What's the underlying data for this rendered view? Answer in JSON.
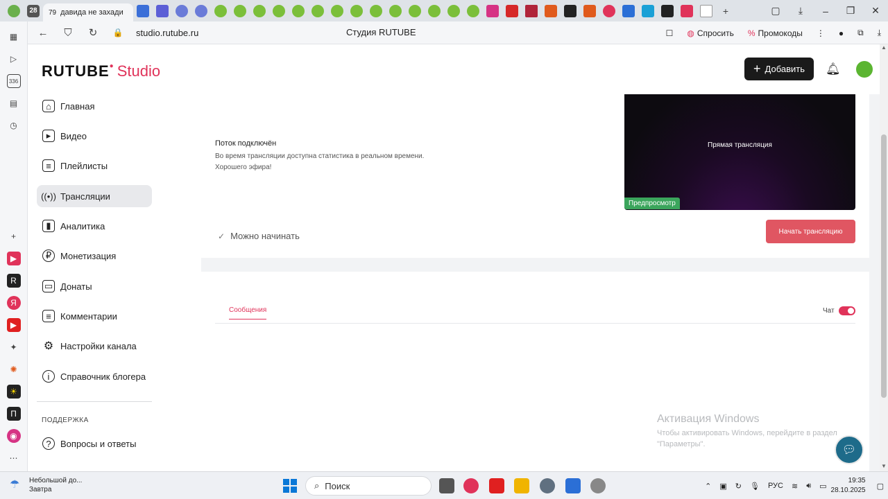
{
  "browser": {
    "active_tab": {
      "count": "79",
      "title": "давида не захади"
    },
    "url": "studio.rutube.ru",
    "page_title": "Студия RUTUBE",
    "ask_label": "Спросить",
    "promo_label": "Промокоды",
    "tab_counter": "28"
  },
  "header": {
    "logo_text": "RUTUBE",
    "logo_studio": "Studio",
    "add_label": "Добавить"
  },
  "sidebar": {
    "items": [
      {
        "label": "Главная",
        "icon": "home-icon"
      },
      {
        "label": "Видео",
        "icon": "video-icon"
      },
      {
        "label": "Плейлисты",
        "icon": "playlist-icon"
      },
      {
        "label": "Трансляции",
        "icon": "broadcast-icon"
      },
      {
        "label": "Аналитика",
        "icon": "analytics-icon"
      },
      {
        "label": "Монетизация",
        "icon": "monetization-icon"
      },
      {
        "label": "Донаты",
        "icon": "donations-icon"
      },
      {
        "label": "Комментарии",
        "icon": "comments-icon"
      },
      {
        "label": "Настройки канала",
        "icon": "gear-icon"
      },
      {
        "label": "Справочник блогера",
        "icon": "info-icon"
      }
    ],
    "support_heading": "ПОДДЕРЖКА",
    "support_items": [
      {
        "label": "Вопросы и ответы",
        "icon": "question-icon"
      }
    ]
  },
  "stream": {
    "status_title": "Поток подключён",
    "desc_line1": "Во время трансляции доступна статистика в реальном времени.",
    "desc_line2": "Хорошего эфира!",
    "preview_title": "Прямая трансляция",
    "preview_badge": "Предпросмотр",
    "ready_label": "Можно начинать",
    "start_button": "Начать трансляцию"
  },
  "chat": {
    "tab_messages": "Сообщения",
    "chat_label": "Чат",
    "enabled": true
  },
  "watermark": {
    "title": "Активация Windows",
    "subtitle": "Чтобы активировать Windows, перейдите в раздел \"Параметры\"."
  },
  "taskbar": {
    "weather_line1": "Небольшой до...",
    "weather_line2": "Завтра",
    "search_placeholder": "Поиск",
    "lang": "РУС",
    "time": "19:35",
    "date": "28.10.2025"
  },
  "colors": {
    "accent": "#e0335a",
    "start_button": "#e05662",
    "preview_badge": "#3ba55c"
  }
}
